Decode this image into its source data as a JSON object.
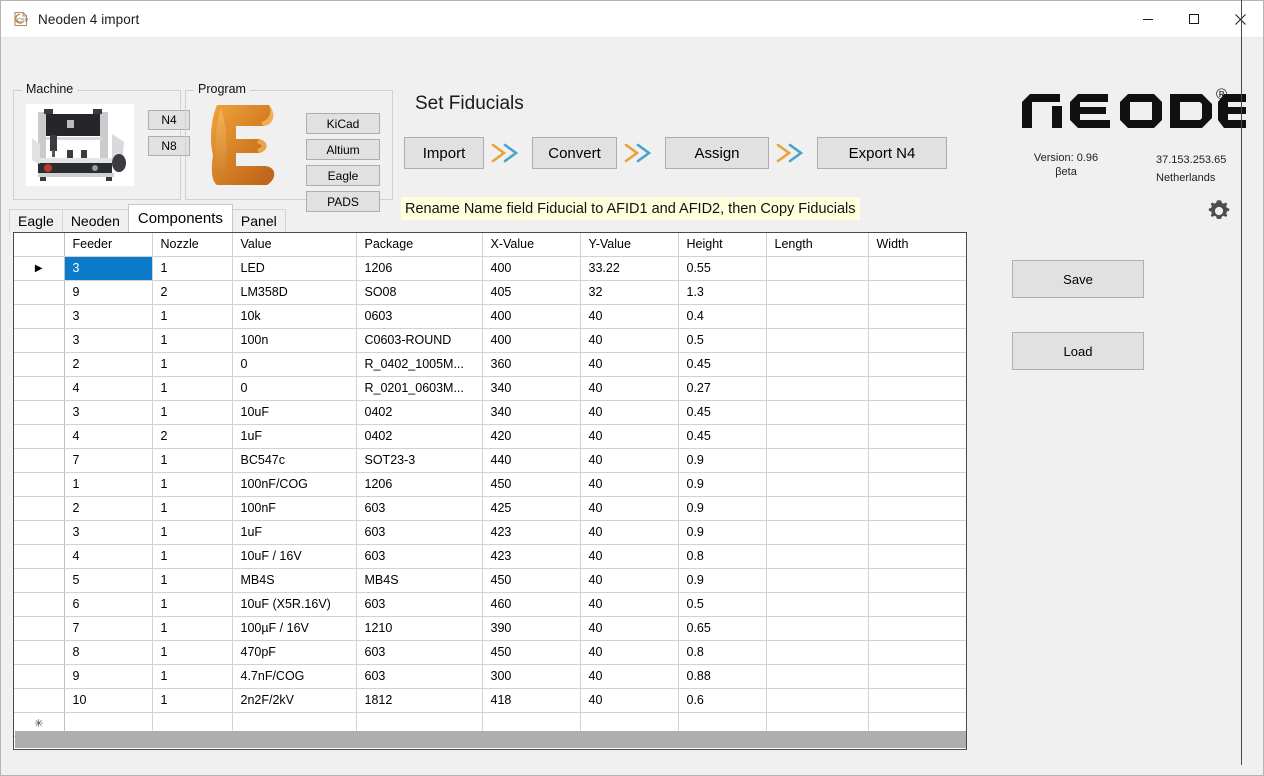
{
  "window": {
    "title": "Neoden 4 import",
    "icon": "csv-file-icon",
    "controls": {
      "minimize": "minimize-icon",
      "maximize": "maximize-icon",
      "close": "close-icon"
    }
  },
  "machine_group": {
    "legend": "Machine",
    "photo_alt": "pick-and-place-machine-photo",
    "buttons": [
      {
        "label": "N4",
        "name": "machine-n4-button"
      },
      {
        "label": "N8",
        "name": "machine-n8-button"
      }
    ]
  },
  "program_group": {
    "legend": "Program",
    "logo_alt": "eagle-logo",
    "buttons": [
      {
        "label": "KiCad",
        "name": "program-kicad-button"
      },
      {
        "label": "Altium",
        "name": "program-altium-button"
      },
      {
        "label": "Eagle",
        "name": "program-eagle-button"
      },
      {
        "label": "PADS",
        "name": "program-pads-button"
      }
    ]
  },
  "workflow": {
    "headline": "Set Fiducials",
    "steps": [
      {
        "label": "Import",
        "name": "import-button"
      },
      {
        "label": "Convert",
        "name": "convert-button"
      },
      {
        "label": "Assign",
        "name": "assign-button"
      },
      {
        "label": "Export N4",
        "name": "export-n4-button"
      }
    ],
    "hint": "Rename Name field  Fiducial to AFID1 and AFID2, then Copy Fiducials",
    "hint_background": "#ffffdd",
    "chevron_colors": {
      "outer": "#e8a33d",
      "inner": "#4ba3c7"
    }
  },
  "branding": {
    "logo_text": "NeoDen",
    "registered_mark": "®",
    "version_line1": "Version: 0.96",
    "version_line2": "βeta",
    "ip_address": "37.153.253.65",
    "country": "Netherlands",
    "settings_icon": "gear-icon"
  },
  "tabs": [
    {
      "label": "Eagle",
      "name": "tab-eagle",
      "active": false
    },
    {
      "label": "Neoden",
      "name": "tab-neoden",
      "active": false
    },
    {
      "label": "Components",
      "name": "tab-components",
      "active": true
    },
    {
      "label": "Panel",
      "name": "tab-panel",
      "active": false
    }
  ],
  "grid": {
    "columns": [
      "Feeder",
      "Nozzle",
      "Value",
      "Package",
      "X-Value",
      "Y-Value",
      "Height",
      "Length",
      "Width"
    ],
    "selected_cell": {
      "row": 0,
      "column": 0,
      "color": "#0b7ac8"
    },
    "current_row_marker": "▶",
    "new_row_marker": "✳",
    "rows": [
      {
        "feeder": "3",
        "nozzle": "1",
        "value": "LED",
        "package": "1206",
        "x": "400",
        "y": "33.22",
        "height": "0.55",
        "length": "",
        "width": ""
      },
      {
        "feeder": "9",
        "nozzle": "2",
        "value": "LM358D",
        "package": "SO08",
        "x": "405",
        "y": "32",
        "height": "1.3",
        "length": "",
        "width": ""
      },
      {
        "feeder": "3",
        "nozzle": "1",
        "value": "10k",
        "package": "0603",
        "x": "400",
        "y": "40",
        "height": "0.4",
        "length": "",
        "width": ""
      },
      {
        "feeder": "3",
        "nozzle": "1",
        "value": "100n",
        "package": "C0603-ROUND",
        "x": "400",
        "y": "40",
        "height": "0.5",
        "length": "",
        "width": ""
      },
      {
        "feeder": "2",
        "nozzle": "1",
        "value": "0",
        "package": "R_0402_1005M...",
        "x": "360",
        "y": "40",
        "height": "0.45",
        "length": "",
        "width": ""
      },
      {
        "feeder": "4",
        "nozzle": "1",
        "value": "0",
        "package": "R_0201_0603M...",
        "x": "340",
        "y": "40",
        "height": "0.27",
        "length": "",
        "width": ""
      },
      {
        "feeder": "3",
        "nozzle": "1",
        "value": "10uF",
        "package": "0402",
        "x": "340",
        "y": "40",
        "height": "0.45",
        "length": "",
        "width": ""
      },
      {
        "feeder": "4",
        "nozzle": "2",
        "value": "1uF",
        "package": "0402",
        "x": "420",
        "y": "40",
        "height": "0.45",
        "length": "",
        "width": ""
      },
      {
        "feeder": "7",
        "nozzle": "1",
        "value": "BC547c",
        "package": "SOT23-3",
        "x": "440",
        "y": "40",
        "height": "0.9",
        "length": "",
        "width": ""
      },
      {
        "feeder": "1",
        "nozzle": "1",
        "value": "100nF/COG",
        "package": "1206",
        "x": "450",
        "y": "40",
        "height": "0.9",
        "length": "",
        "width": ""
      },
      {
        "feeder": "2",
        "nozzle": "1",
        "value": "100nF",
        "package": "603",
        "x": "425",
        "y": "40",
        "height": "0.9",
        "length": "",
        "width": ""
      },
      {
        "feeder": "3",
        "nozzle": "1",
        "value": "1uF",
        "package": "603",
        "x": "423",
        "y": "40",
        "height": "0.9",
        "length": "",
        "width": ""
      },
      {
        "feeder": "4",
        "nozzle": "1",
        "value": "10uF / 16V",
        "package": "603",
        "x": "423",
        "y": "40",
        "height": "0.8",
        "length": "",
        "width": ""
      },
      {
        "feeder": "5",
        "nozzle": "1",
        "value": "MB4S",
        "package": "MB4S",
        "x": "450",
        "y": "40",
        "height": "0.9",
        "length": "",
        "width": ""
      },
      {
        "feeder": "6",
        "nozzle": "1",
        "value": "10uF (X5R.16V)",
        "package": "603",
        "x": "460",
        "y": "40",
        "height": "0.5",
        "length": "",
        "width": ""
      },
      {
        "feeder": "7",
        "nozzle": "1",
        "value": "100µF / 16V",
        "package": "1210",
        "x": "390",
        "y": "40",
        "height": "0.65",
        "length": "",
        "width": ""
      },
      {
        "feeder": "8",
        "nozzle": "1",
        "value": "470pF",
        "package": "603",
        "x": "450",
        "y": "40",
        "height": "0.8",
        "length": "",
        "width": ""
      },
      {
        "feeder": "9",
        "nozzle": "1",
        "value": "4.7nF/COG",
        "package": "603",
        "x": "300",
        "y": "40",
        "height": "0.88",
        "length": "",
        "width": ""
      },
      {
        "feeder": "10",
        "nozzle": "1",
        "value": "2n2F/2kV",
        "package": "1812",
        "x": "418",
        "y": "40",
        "height": "0.6",
        "length": "",
        "width": ""
      }
    ]
  },
  "side_actions": [
    {
      "label": "Save",
      "name": "save-button"
    },
    {
      "label": "Load",
      "name": "load-button"
    }
  ]
}
